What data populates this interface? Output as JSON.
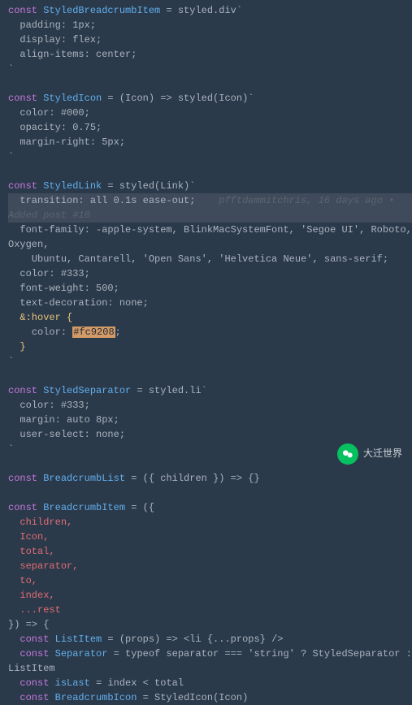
{
  "code": {
    "sbi": {
      "decl": "const",
      "name": "StyledBreadcrumbItem",
      "assign": " = styled.div`",
      "lines": [
        "  padding: 1px;",
        "  display: flex;",
        "  align-items: center;"
      ],
      "close": "`"
    },
    "icon": {
      "decl": "const",
      "name": "StyledIcon",
      "assign": " = (Icon) => styled(Icon)`",
      "lines": [
        "  color: #000;",
        "  opacity: 0.75;",
        "  margin-right: 5px;"
      ],
      "close": "`"
    },
    "link": {
      "decl": "const",
      "name": "StyledLink",
      "assign": " = styled(Link)`",
      "hl_line": "  transition: all 0.1s ease-out;",
      "annotation": "    pfftdammitchris, 16 days ago • Added post #10",
      "ff1": "  font-family: -apple-system, BlinkMacSystemFont, 'Segoe UI', Roboto, Oxygen,",
      "ff2": "    Ubuntu, Cantarell, 'Open Sans', 'Helvetica Neue', sans-serif;",
      "lines": [
        "  color: #333;",
        "  font-weight: 500;",
        "  text-decoration: none;"
      ],
      "hover": "  &:hover {",
      "hover_color_prop": "    color: ",
      "hover_color_val": "#fc9208",
      "hover_semi": ";",
      "hover_close": "  }",
      "close": "`"
    },
    "sep": {
      "decl": "const",
      "name": "StyledSeparator",
      "assign": " = styled.li`",
      "lines": [
        "  color: #333;",
        "  margin: auto 8px;",
        "  user-select: none;"
      ],
      "close": "`"
    },
    "list": {
      "decl": "const",
      "name": "BreadcrumbList",
      "assign": " = ({ children }) => {}"
    },
    "item": {
      "decl": "const",
      "name": "BreadcrumbItem",
      "assign": " = ({",
      "props": [
        "  children,",
        "  Icon,",
        "  total,",
        "  separator,",
        "  to,",
        "  index,",
        "  ...rest"
      ],
      "arrow": "}) => {",
      "body": [
        {
          "decl": "const",
          "name": "ListItem",
          "rest": " = (props) => <li {...props} />"
        },
        {
          "decl": "const",
          "name": "Separator",
          "rest": " = typeof separator === 'string' ? StyledSeparator : ListItem"
        },
        {
          "decl": "const",
          "name": "isLast",
          "rest": " = index < total"
        },
        {
          "decl": "const",
          "name": "BreadcrumbIcon",
          "rest": " = StyledIcon(Icon)"
        }
      ]
    }
  },
  "watermark": {
    "label": "大迁世界"
  }
}
